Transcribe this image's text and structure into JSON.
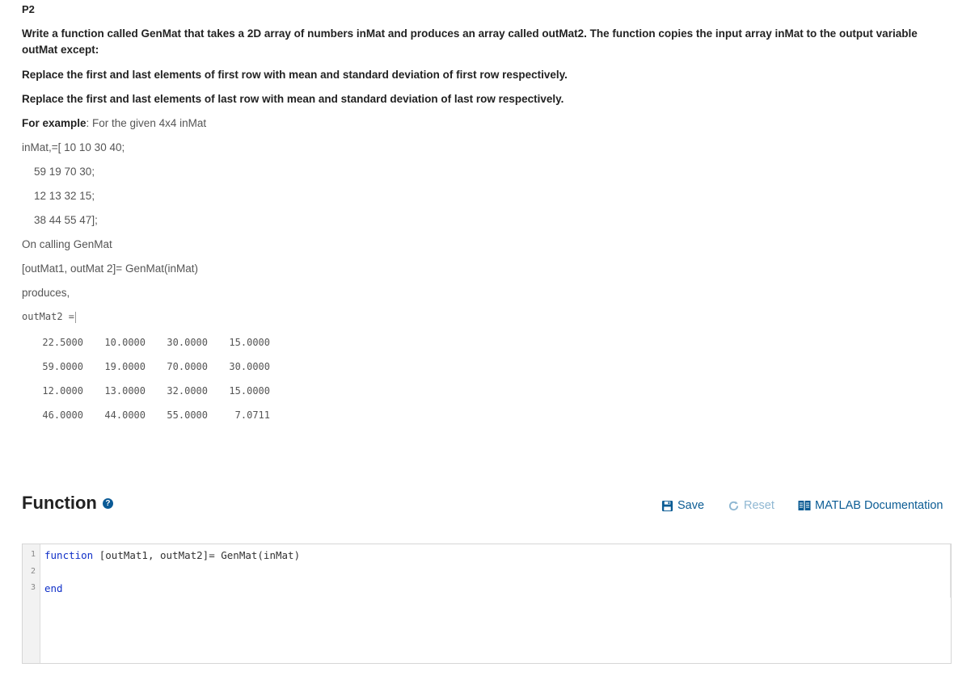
{
  "problem": {
    "label": "P2",
    "intro": "Write a function called GenMat that takes a 2D array of numbers inMat and produces an array called outMat2.  The function copies the input array inMat to the output variable outMat except:",
    "rule1": "Replace the first and last elements of first row with mean and standard deviation of first row respectively.",
    "rule2": "Replace the first and last elements of last row with mean and standard deviation of last row respectively.",
    "example_label": "For example",
    "example_text": ": For the given 4x4 inMat",
    "inmat_lines": [
      "inMat,=[ 10 10 30 40;",
      "59 19 70 30;",
      "12 13 32 15;",
      "38 44 55 47];"
    ],
    "on_calling": "On calling GenMat",
    "call_line": "[outMat1, outMat 2]= GenMat(inMat)",
    "produces": "produces,",
    "output_label": "outMat2  =",
    "output_rows": [
      [
        "22.5000",
        "10.0000",
        "30.0000",
        "15.0000"
      ],
      [
        "59.0000",
        "19.0000",
        "70.0000",
        "30.0000"
      ],
      [
        "12.0000",
        "13.0000",
        "32.0000",
        "15.0000"
      ],
      [
        "46.0000",
        "44.0000",
        "55.0000",
        "7.0711"
      ]
    ]
  },
  "function_section": {
    "heading": "Function",
    "help_icon": "question-circle-icon",
    "save_label": "Save",
    "reset_label": "Reset",
    "doc_label": "MATLAB Documentation",
    "colors": {
      "link": "#0b5c94",
      "disabled": "#8fb7d2",
      "keyword": "#1030c8"
    }
  },
  "editor": {
    "line_numbers": [
      "1",
      "2",
      "3"
    ],
    "line1_keyword": "function",
    "line1_rest": " [outMat1, outMat2]= GenMat(inMat)",
    "line3_keyword": "end"
  }
}
